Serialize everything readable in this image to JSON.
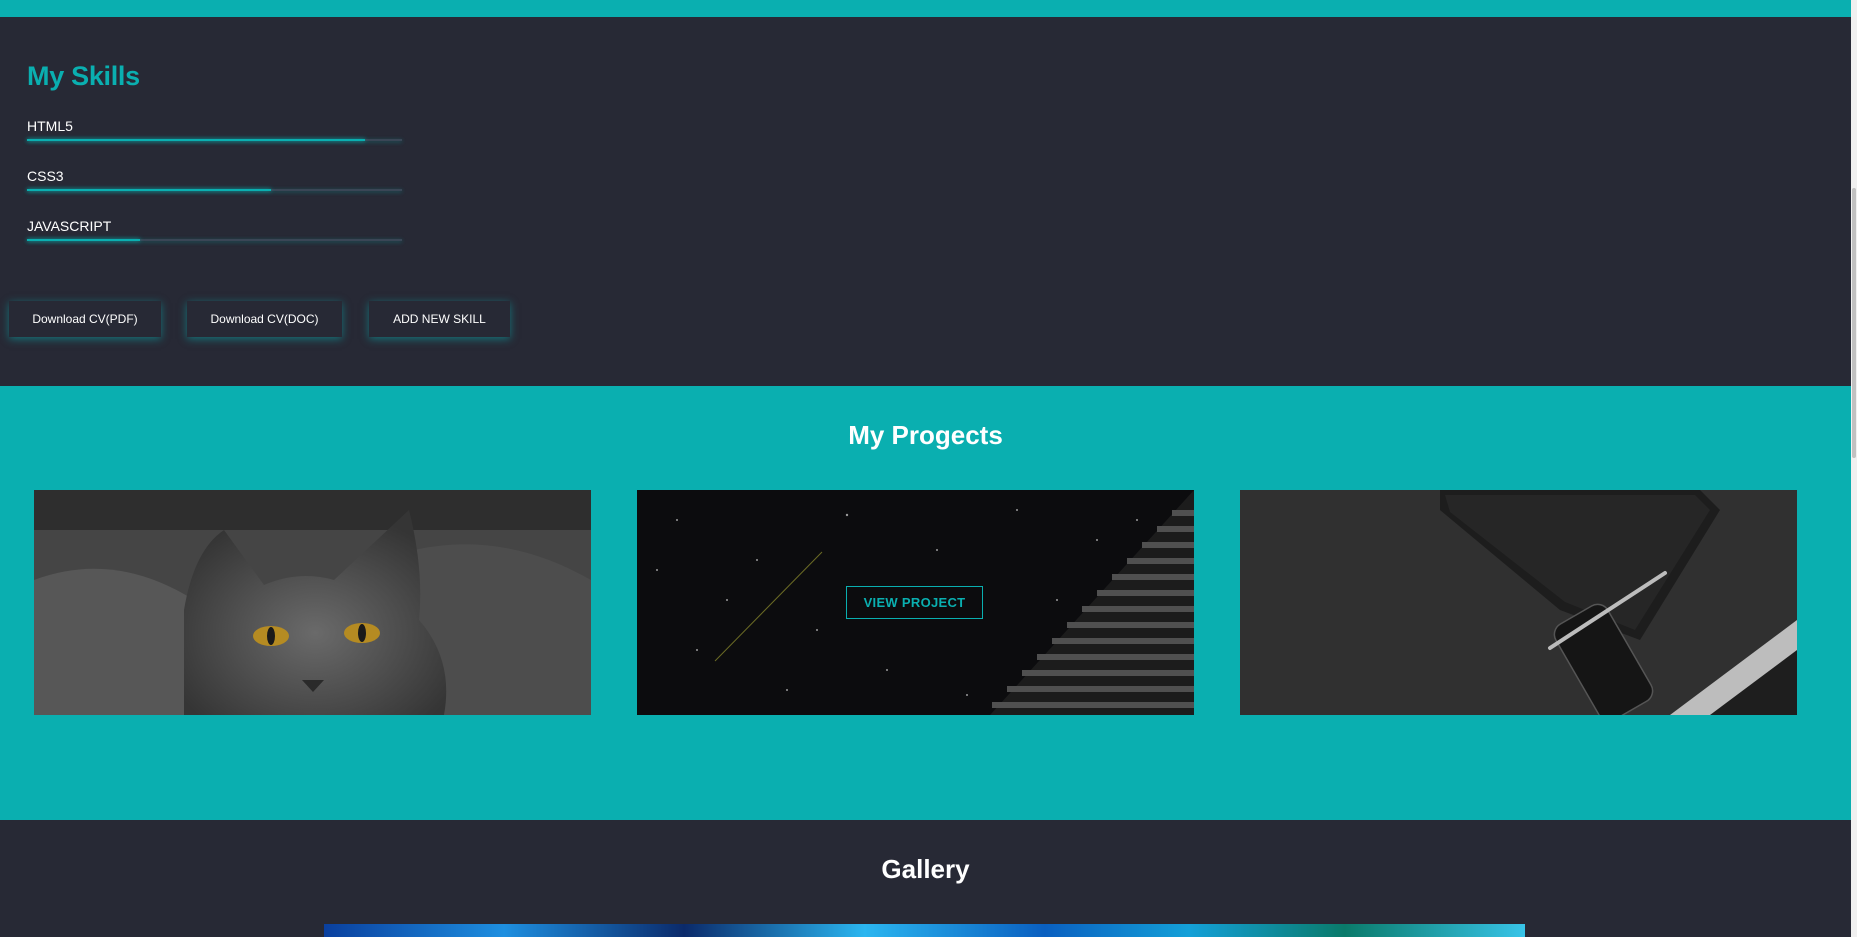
{
  "skills": {
    "title": "My Skills",
    "items": [
      {
        "label": "HTML5",
        "level": 0.9
      },
      {
        "label": "CSS3",
        "level": 0.65
      },
      {
        "label": "JAVASCRIPT",
        "level": 0.3
      }
    ]
  },
  "buttons": {
    "cv_pdf": "Download CV(PDF)",
    "cv_doc": "Download CV(DOC)",
    "add_skill": "ADD NEW SKILL"
  },
  "projects": {
    "title": "My Progects",
    "view_label": "VIEW PROJECT"
  },
  "gallery": {
    "title": "Gallery"
  },
  "colors": {
    "accent": "#0aafb0",
    "dark": "#272935"
  }
}
